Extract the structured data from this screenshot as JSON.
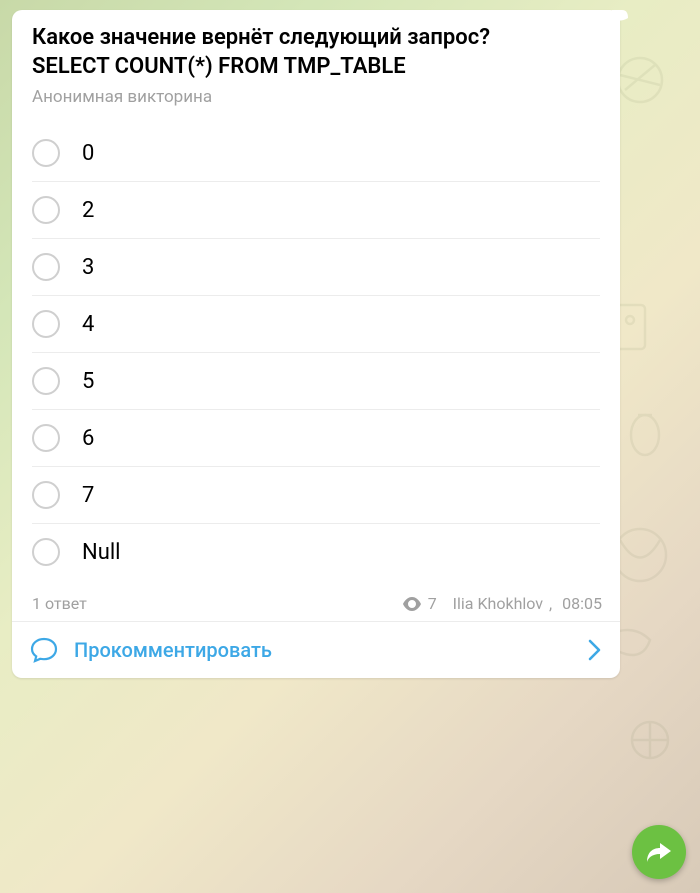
{
  "poll": {
    "question": "Какое значение вернёт следующий запрос?\nSELECT COUNT(*)  FROM  TMP_TABLE",
    "type_label": "Анонимная викторина",
    "options": [
      {
        "label": "0"
      },
      {
        "label": "2"
      },
      {
        "label": "3"
      },
      {
        "label": "4"
      },
      {
        "label": "5"
      },
      {
        "label": "6"
      },
      {
        "label": "7"
      },
      {
        "label": "Null"
      }
    ]
  },
  "footer": {
    "answers_text": "1 ответ",
    "views": "7",
    "author": "Ilia Khokhlov",
    "time": "08:05"
  },
  "comment": {
    "label": "Прокомментировать"
  }
}
